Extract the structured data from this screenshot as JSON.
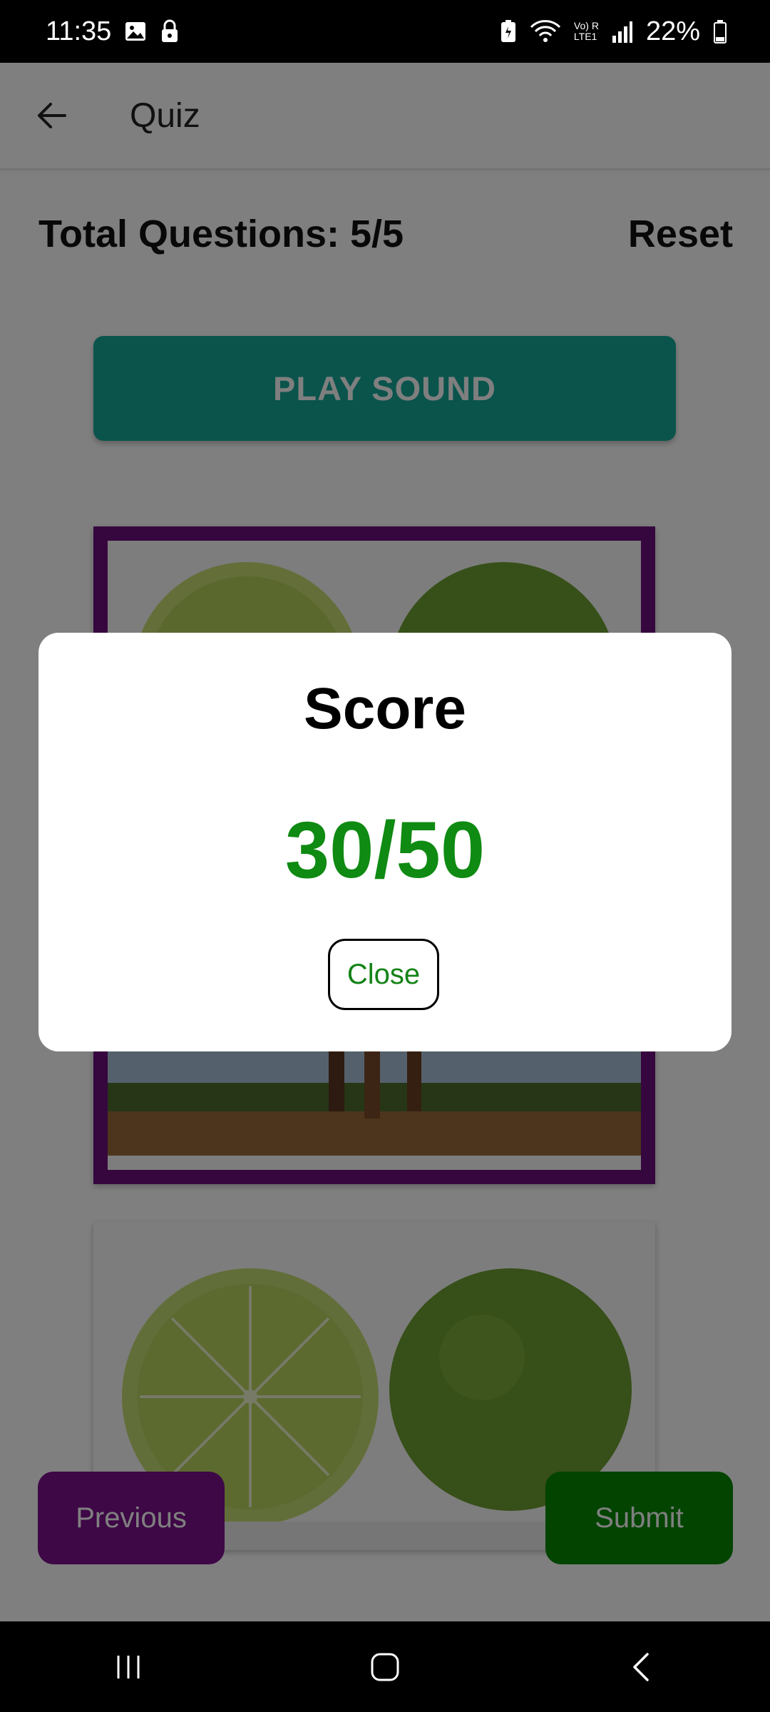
{
  "status_bar": {
    "time": "11:35",
    "battery": "22%",
    "left_icons": [
      "gallery-icon",
      "lock-icon"
    ],
    "right_icons": [
      "battery-saver-icon",
      "wifi-icon",
      "volte-icon",
      "signal-icon",
      "battery-icon"
    ],
    "network_label": "Vo) R\nLTE1"
  },
  "app_bar": {
    "title": "Quiz"
  },
  "quiz": {
    "total_questions": "Total Questions: 5/5",
    "reset_label": "Reset",
    "play_sound_label": "PLAY SOUND",
    "previous_label": "Previous",
    "submit_label": "Submit",
    "options": [
      {
        "image": "lime-horse-image"
      },
      {
        "image": "lime-image"
      }
    ]
  },
  "dialog": {
    "title": "Score",
    "score": "30/50",
    "close_label": "Close"
  },
  "colors": {
    "play_button": "#15a899",
    "selected_border": "#6c0f7c",
    "previous_button": "#7c0e8c",
    "submit_button": "#058800",
    "score_text": "#0f8a12"
  }
}
